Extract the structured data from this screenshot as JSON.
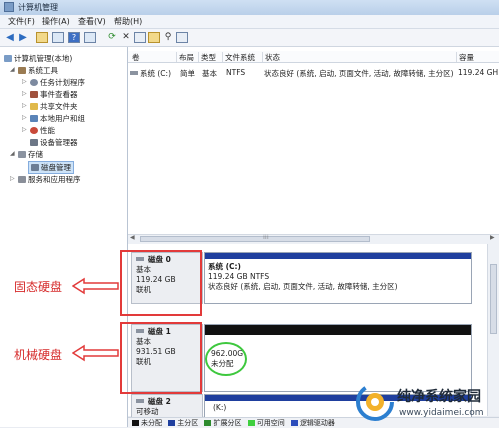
{
  "window": {
    "title": "计算机管理"
  },
  "menu": [
    "文件(F)",
    "操作(A)",
    "查看(V)",
    "帮助(H)"
  ],
  "toolbar": {
    "icons": [
      "back-arrow-icon",
      "forward-arrow-icon",
      "up-folder-icon",
      "show-tree-icon",
      "help-icon",
      "properties-icon",
      "refresh-icon",
      "delete-icon",
      "check-disk-icon",
      "open-icon",
      "search-icon",
      "more-icon"
    ]
  },
  "tree": {
    "root": "计算机管理(本地)",
    "items": [
      {
        "label": "系统工具",
        "level": 1,
        "expand": "◢"
      },
      {
        "label": "任务计划程序",
        "level": 2,
        "expand": "▷"
      },
      {
        "label": "事件查看器",
        "level": 2,
        "expand": "▷"
      },
      {
        "label": "共享文件夹",
        "level": 2,
        "expand": "▷"
      },
      {
        "label": "本地用户和组",
        "level": 2,
        "expand": "▷"
      },
      {
        "label": "性能",
        "level": 2,
        "expand": "▷"
      },
      {
        "label": "设备管理器",
        "level": 2,
        "expand": ""
      },
      {
        "label": "存储",
        "level": 1,
        "expand": "◢"
      },
      {
        "label": "磁盘管理",
        "level": 2,
        "expand": "",
        "selected": true
      },
      {
        "label": "服务和应用程序",
        "level": 1,
        "expand": "▷"
      }
    ]
  },
  "volume_list": {
    "columns": [
      "卷",
      "布局",
      "类型",
      "文件系统",
      "状态",
      "容量"
    ],
    "rows": [
      {
        "volume": "系统 (C:)",
        "layout": "简单",
        "type": "基本",
        "fs": "NTFS",
        "status": "状态良好 (系统, 启动, 页面文件, 活动, 故障转储, 主分区)",
        "capacity": "119.24 GH"
      }
    ]
  },
  "disks": [
    {
      "name": "磁盘 0",
      "type": "基本",
      "size": "119.24 GB",
      "state": "联机",
      "partition": {
        "title": "系统 (C:)",
        "line1": "119.24 GB NTFS",
        "line2": "状态良好 (系统, 启动, 页面文件, 活动, 故障转储, 主分区)"
      }
    },
    {
      "name": "磁盘 1",
      "type": "基本",
      "size": "931.51 GB",
      "state": "联机",
      "partition": {
        "title": "",
        "line1": "962.00G",
        "line2": "未分配"
      }
    },
    {
      "name": "磁盘 2",
      "type": "可移动",
      "size": "",
      "state": "",
      "partition": {
        "title": "(K:)",
        "line1": "",
        "line2": ""
      }
    }
  ],
  "annotations": {
    "label_ssd": "固态硬盘",
    "label_hdd": "机械硬盘"
  },
  "legend": [
    {
      "label": "未分配",
      "color": "#111111"
    },
    {
      "label": "主分区",
      "color": "#1f3f9e"
    },
    {
      "label": "扩展分区",
      "color": "#2e8b2e"
    },
    {
      "label": "可用空间",
      "color": "#3fcf3f"
    },
    {
      "label": "逻辑驱动器",
      "color": "#2c4dbb"
    }
  ],
  "watermark": {
    "text": "纯净系统家园",
    "url": "www.yidaimei.com"
  },
  "colors": {
    "primary_band": "#1f3f9e",
    "unallocated_band": "#111111",
    "highlight_red": "#e23a3a",
    "highlight_green": "#3ec83e"
  }
}
